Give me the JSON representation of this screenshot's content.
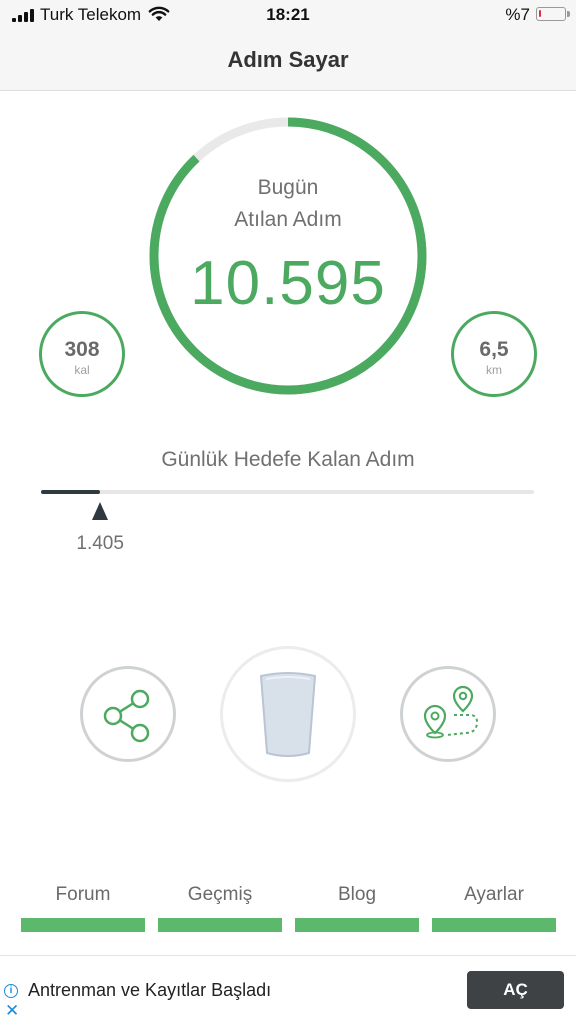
{
  "status_bar": {
    "carrier": "Turk Telekom",
    "time": "18:21",
    "battery_text": "%7",
    "battery_level": 0.07,
    "icons": [
      "signal-icon",
      "wifi-icon",
      "battery-icon"
    ]
  },
  "nav": {
    "title": "Adım Sayar"
  },
  "today": {
    "line1": "Bugün",
    "line2": "Atılan Adım",
    "steps": "10.595",
    "ring_progress": 0.88
  },
  "calories": {
    "value": "308",
    "unit": "kal"
  },
  "distance": {
    "value": "6,5",
    "unit": "km"
  },
  "goal": {
    "label": "Günlük Hedefe Kalan Adım",
    "remaining": "1.405",
    "progress": 0.12
  },
  "actions": {
    "icons": [
      "share-icon",
      "water-glass-icon",
      "route-map-icon"
    ]
  },
  "tabs": [
    {
      "label": "Forum"
    },
    {
      "label": "Geçmiş"
    },
    {
      "label": "Blog"
    },
    {
      "label": "Ayarlar"
    }
  ],
  "ad": {
    "text": "Antrenman ve Kayıtlar Başladı",
    "button": "AÇ",
    "info_glyph": "i",
    "close_glyph": "✕"
  },
  "colors": {
    "accent": "#4ca960",
    "tab_bar": "#5cb86a",
    "progress_dark": "#2f3a40",
    "ad_button": "#3f4245",
    "battery_low": "#e0313a"
  }
}
